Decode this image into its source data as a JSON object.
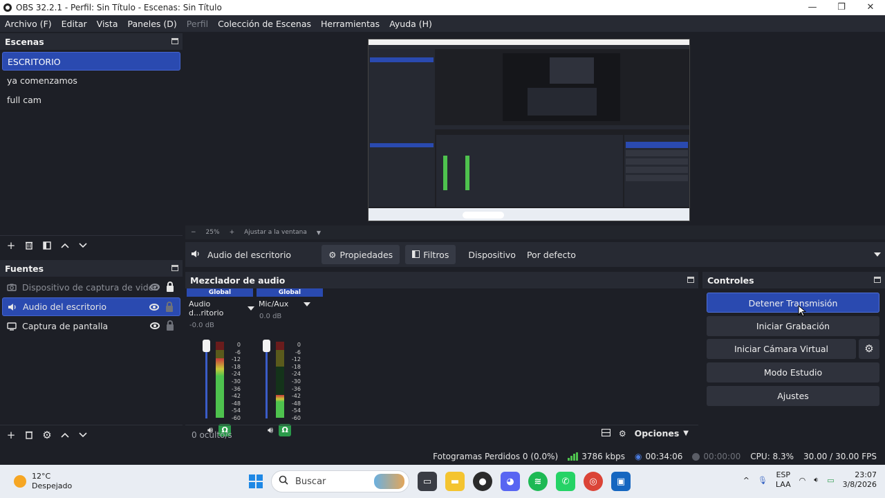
{
  "window": {
    "title": "OBS 32.2.1 - Perfil: Sin Título - Escenas: Sin Título",
    "minimize": "—",
    "maximize": "❐",
    "close": "✕"
  },
  "menu": {
    "items": [
      "Archivo (F)",
      "Editar",
      "Vista",
      "Paneles (D)",
      "Perfil",
      "Colección de Escenas",
      "Herramientas",
      "Ayuda (H)"
    ]
  },
  "scenes": {
    "title": "Escenas",
    "items": [
      "ESCRITORIO",
      "ya comenzamos",
      "full cam"
    ],
    "active_index": 0
  },
  "sources": {
    "title": "Fuentes",
    "items": [
      {
        "label": "Dispositivo de captura de video",
        "icon": "camera-icon",
        "visible": false,
        "locked": true
      },
      {
        "label": "Audio del escritorio",
        "icon": "speaker-icon",
        "visible": true,
        "locked": false
      },
      {
        "label": "Captura de pantalla",
        "icon": "monitor-icon",
        "visible": true,
        "locked": false
      }
    ],
    "active_index": 1
  },
  "preview": {
    "zoom": "25%",
    "fit_label": "Ajustar a la ventana"
  },
  "source_bar": {
    "source_name": "Audio del escritorio",
    "properties_label": "Propiedades",
    "filters_label": "Filtros",
    "device_label": "Dispositivo",
    "device_value": "Por defecto"
  },
  "mixer": {
    "title": "Mezclador de audio",
    "channels": [
      {
        "tag": "Global",
        "name": "Audio d...ritorio",
        "db": "-0.0 dB",
        "level": 0.78
      },
      {
        "tag": "Global",
        "name": "Mic/Aux",
        "db": "0.0 dB",
        "level": 0.3
      }
    ],
    "scale": [
      "0",
      "-6",
      "-12",
      "-18",
      "-24",
      "-30",
      "-36",
      "-42",
      "-48",
      "-54",
      "-60"
    ],
    "hidden_count": "0 oculto/s",
    "options_label": "Opciones"
  },
  "controls": {
    "title": "Controles",
    "stop_stream": "Detener Transmisión",
    "start_recording": "Iniciar Grabación",
    "start_virtual_cam": "Iniciar Cámara Virtual",
    "studio_mode": "Modo Estudio",
    "settings": "Ajustes"
  },
  "status": {
    "dropped_frames": "Fotogramas Perdidos 0 (0.0%)",
    "bitrate": "3786 kbps",
    "stream_time": "00:34:06",
    "record_time": "00:00:00",
    "cpu": "CPU: 8.3%",
    "fps": "30.00 / 30.00 FPS"
  },
  "taskbar": {
    "temperature": "12°C",
    "weather": "Despejado",
    "search_placeholder": "Buscar",
    "lang_top": "ESP",
    "lang_bottom": "LAA",
    "time": "23:07",
    "date": "3/8/2026"
  },
  "colors": {
    "accent": "#2a4ab0",
    "bg": "#1d1f26",
    "dock_header": "#272a33",
    "meter_green": "#4ec24e"
  }
}
